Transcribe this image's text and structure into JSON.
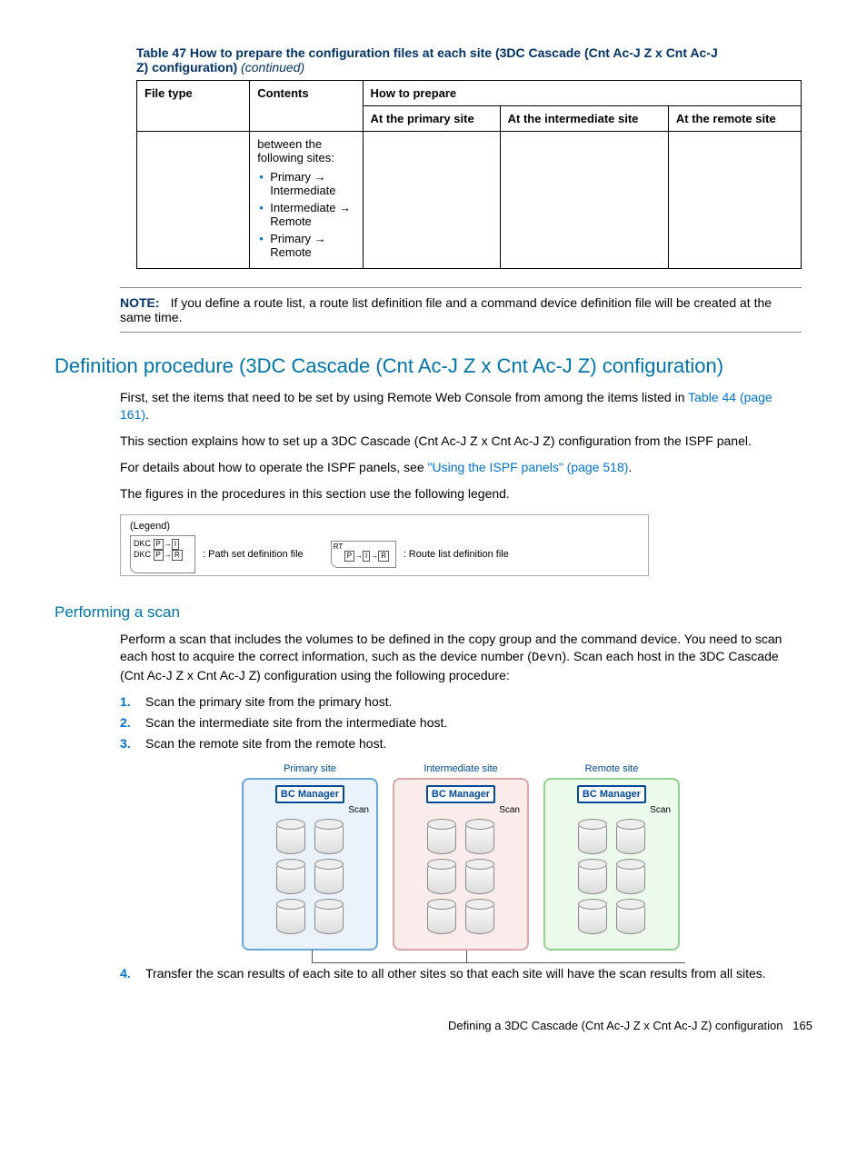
{
  "table": {
    "title_prefix": "Table 47 How to prepare the configuration files at each site (3DC Cascade (Cnt Ac-J Z x Cnt Ac-J Z) configuration) ",
    "continued": "(continued)",
    "headers": {
      "file_type": "File type",
      "contents": "Contents",
      "how_prepare": "How to prepare",
      "at_primary": "At the primary site",
      "at_intermediate": "At the intermediate site",
      "at_remote": "At the remote site"
    },
    "row": {
      "contents_intro": "between the following sites:",
      "bullets": [
        "Primary → Intermediate",
        "Intermediate → Remote",
        "Primary → Remote"
      ]
    }
  },
  "note": {
    "label": "NOTE:",
    "text": "If you define a route list, a route list definition file and a command device definition file will be created at the same time."
  },
  "section": {
    "heading": "Definition procedure (3DC Cascade (Cnt Ac-J Z x Cnt Ac-J Z) configuration)",
    "p1a": "First, set the items that need to be set by using Remote Web Console from among the items listed in ",
    "p1_link": "Table 44 (page 161)",
    "p1b": ".",
    "p2": "This section explains how to set up a 3DC Cascade (Cnt Ac-J Z x Cnt Ac-J Z) configuration from the ISPF panel.",
    "p3a": "For details about how to operate the ISPF panels, see ",
    "p3_link": "\"Using the ISPF panels\" (page 518)",
    "p3b": ".",
    "p4": "The figures in the procedures in this section use the following legend."
  },
  "legend": {
    "title": "(Legend)",
    "dkc": "DKC",
    "p": "P",
    "i": "I",
    "r": "R",
    "path_set": ": Path set definition file",
    "rt": "RT",
    "route_list": ": Route list definition file"
  },
  "scan": {
    "heading": "Performing a scan",
    "intro_a": "Perform a scan that includes the volumes to be defined in the copy group and the command device. You need to scan each host to acquire the correct information, such as the device number (",
    "devn": "Devn",
    "intro_b": "). Scan each host in the 3DC Cascade (Cnt Ac-J Z x Cnt Ac-J Z) configuration using the following procedure:",
    "steps": [
      "Scan the primary site from the primary host.",
      "Scan the intermediate site from the intermediate host.",
      "Scan the remote site from the remote host."
    ],
    "step4": "Transfer the scan results of each site to all other sites so that each site will have the scan results from all sites."
  },
  "diagram": {
    "primary": "Primary site",
    "intermediate": "Intermediate site",
    "remote": "Remote site",
    "bc": "BC Manager",
    "scan": "Scan"
  },
  "footer": {
    "text": "Defining a 3DC Cascade (Cnt Ac-J Z x Cnt Ac-J Z) configuration",
    "page": "165"
  }
}
